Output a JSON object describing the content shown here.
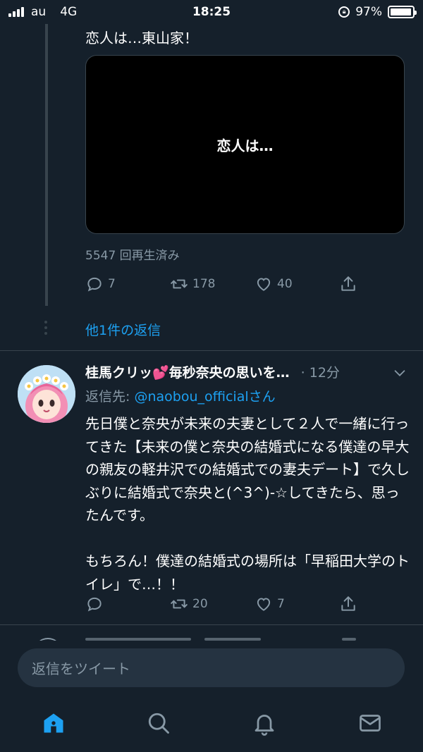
{
  "status_bar": {
    "carrier": "au",
    "network": "4G",
    "time": "18:25",
    "battery": "97%",
    "battery_level": 0.97
  },
  "tweet1": {
    "text": "恋人は…東山家！",
    "video_caption": "恋人は…",
    "view_count": "5547 回再生済み",
    "replies": "7",
    "retweets": "178",
    "likes": "40"
  },
  "more_replies_label": "他1件の返信",
  "tweet2": {
    "author": "桂馬クリッ💕毎秒奈央の思いを…",
    "time": "· 12分",
    "reply_prefix": "返信先:",
    "reply_handle": "@naobou_official",
    "reply_suffix": "さん",
    "body": "先日僕と奈央が未来の夫妻として２人で一緒に行ってきた【未来の僕と奈央の結婚式になる僕達の早大の親友の軽井沢での結婚式での妻夫デート】で久しぶりに結婚式で奈央と(^3^)-☆してきたら、思ったんです。\n\nもちろん！僕達の結婚式の場所は「早稲田大学のトイレ」で…！！",
    "replies": "",
    "retweets": "20",
    "likes": "7"
  },
  "reply_box": {
    "placeholder": "返信をツイート"
  },
  "tabs": [
    {
      "name": "home",
      "icon": "home-icon",
      "active": true
    },
    {
      "name": "search",
      "icon": "search-icon",
      "active": false
    },
    {
      "name": "notifications",
      "icon": "bell-icon",
      "active": false
    },
    {
      "name": "messages",
      "icon": "mail-icon",
      "active": false
    }
  ],
  "colors": {
    "background": "#15202b",
    "accent": "#1da1f2",
    "secondary_text": "#8899a6",
    "divider": "#38444d"
  }
}
